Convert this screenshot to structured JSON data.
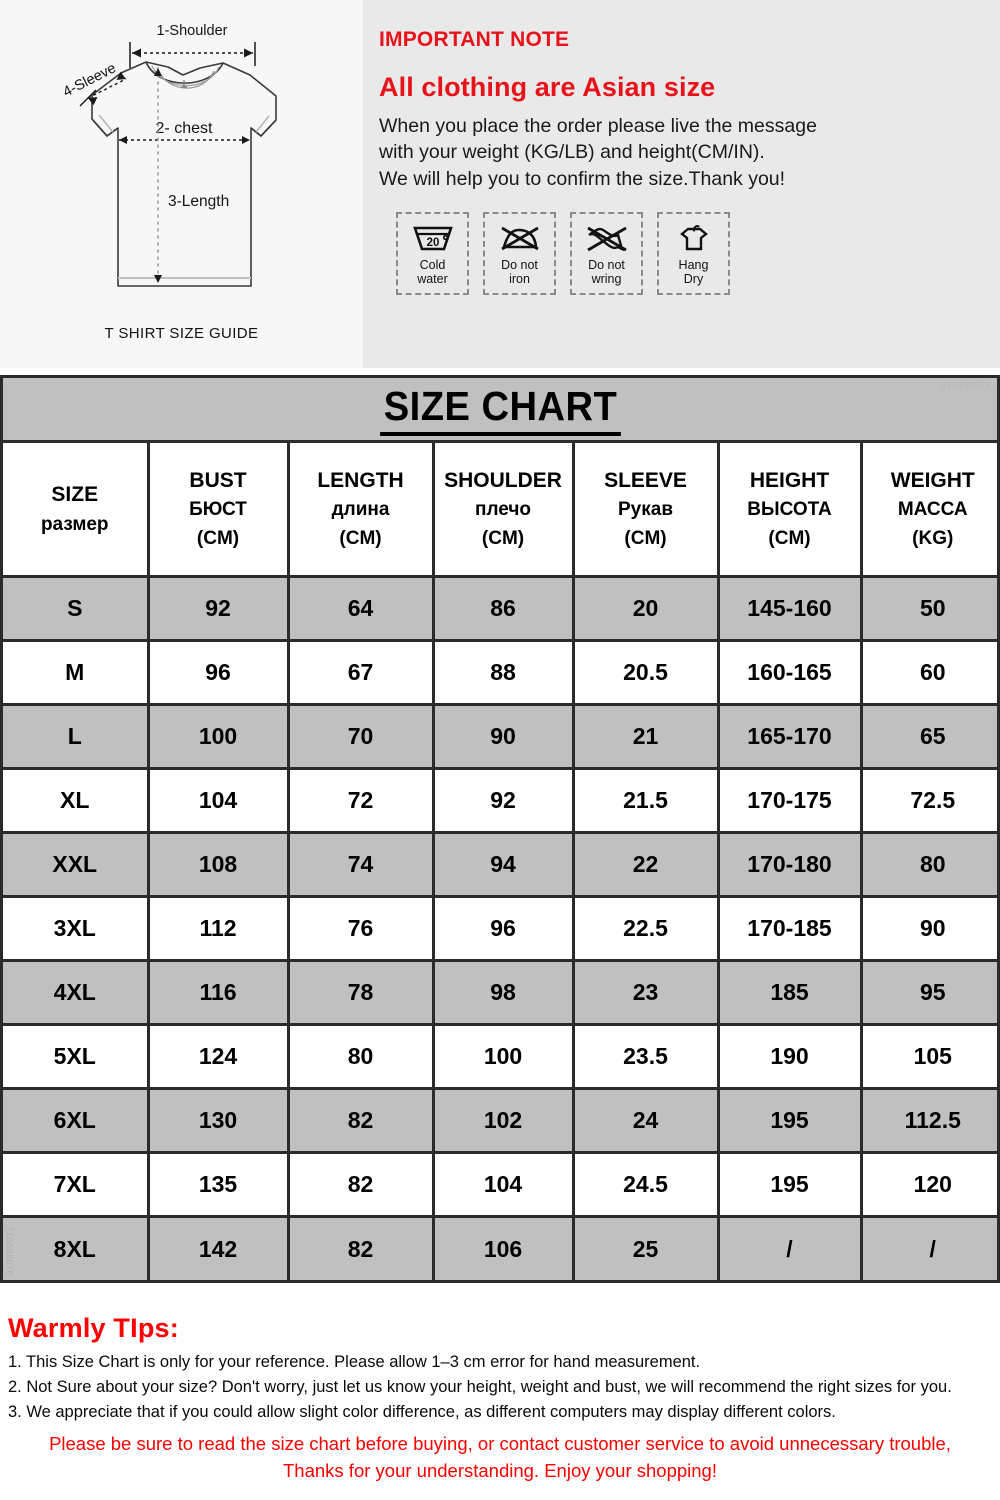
{
  "diagram": {
    "caption": "T SHIRT SIZE GUIDE",
    "labels": {
      "shoulder": "1-Shoulder",
      "sleeve": "4-Sleeve",
      "chest": "2- chest",
      "length": "3-Length"
    }
  },
  "note": {
    "title": "IMPORTANT NOTE",
    "headline": "All clothing are Asian size",
    "body_lines": [
      "When you place the order please live the message",
      "with your weight (KG/LB) and height(CM/IN).",
      "We will help you to confirm the size.Thank you!"
    ],
    "color": "#e8131a"
  },
  "care": [
    {
      "icon": "cold-water-icon",
      "label_lines": [
        "Cold",
        "water"
      ],
      "temp": "20"
    },
    {
      "icon": "do-not-iron-icon",
      "label_lines": [
        "Do not",
        "iron"
      ]
    },
    {
      "icon": "do-not-wring-icon",
      "label_lines": [
        "Do not",
        "wring"
      ]
    },
    {
      "icon": "hang-dry-icon",
      "label_lines": [
        "Hang",
        "Dry"
      ]
    }
  ],
  "table": {
    "title": "SIZE CHART",
    "watermark": "910459071",
    "header_colors": {
      "band": "#c0c0c0",
      "alt_row": "#c0c0c0"
    },
    "columns": [
      {
        "line1": "SIZE",
        "line2": "размер",
        "line3": ""
      },
      {
        "line1": "BUST",
        "line2": "БЮСТ",
        "line3": "(CM)"
      },
      {
        "line1": "LENGTH",
        "line2": "длина",
        "line3": "(CM)"
      },
      {
        "line1": "SHOULDER",
        "line2": "плечо",
        "line3": "(CM)"
      },
      {
        "line1": "SLEEVE",
        "line2": "Рукав",
        "line3": "(CM)"
      },
      {
        "line1": "HEIGHT",
        "line2": "ВЫСОТА",
        "line3": "(CM)"
      },
      {
        "line1": "WEIGHT",
        "line2": "МАССА",
        "line3": "(KG)"
      }
    ],
    "rows": [
      [
        "S",
        "92",
        "64",
        "86",
        "20",
        "145-160",
        "50"
      ],
      [
        "M",
        "96",
        "67",
        "88",
        "20.5",
        "160-165",
        "60"
      ],
      [
        "L",
        "100",
        "70",
        "90",
        "21",
        "165-170",
        "65"
      ],
      [
        "XL",
        "104",
        "72",
        "92",
        "21.5",
        "170-175",
        "72.5"
      ],
      [
        "XXL",
        "108",
        "74",
        "94",
        "22",
        "170-180",
        "80"
      ],
      [
        "3XL",
        "112",
        "76",
        "96",
        "22.5",
        "170-185",
        "90"
      ],
      [
        "4XL",
        "116",
        "78",
        "98",
        "23",
        "185",
        "95"
      ],
      [
        "5XL",
        "124",
        "80",
        "100",
        "23.5",
        "190",
        "105"
      ],
      [
        "6XL",
        "130",
        "82",
        "102",
        "24",
        "195",
        "112.5"
      ],
      [
        "7XL",
        "135",
        "82",
        "104",
        "24.5",
        "195",
        "120"
      ],
      [
        "8XL",
        "142",
        "82",
        "106",
        "25",
        "/",
        "/"
      ]
    ]
  },
  "tips": {
    "title": "Warmly TIps:",
    "lines": [
      "1. This Size Chart is only for your reference. Please allow 1–3 cm error for hand measurement.",
      "2. Not Sure about your size? Don't worry, just let us know your height, weight and bust, we will recommend the right sizes for you.",
      "3. We appreciate that if you could allow slight color difference, as different computers may display different colors."
    ],
    "final_lines": [
      "Please be sure to read the size chart before buying, or contact customer service to avoid unnecessary trouble,",
      "Thanks for your understanding. Enjoy your shopping!"
    ],
    "title_color": "#ff0000",
    "final_color": "#ff0000"
  }
}
